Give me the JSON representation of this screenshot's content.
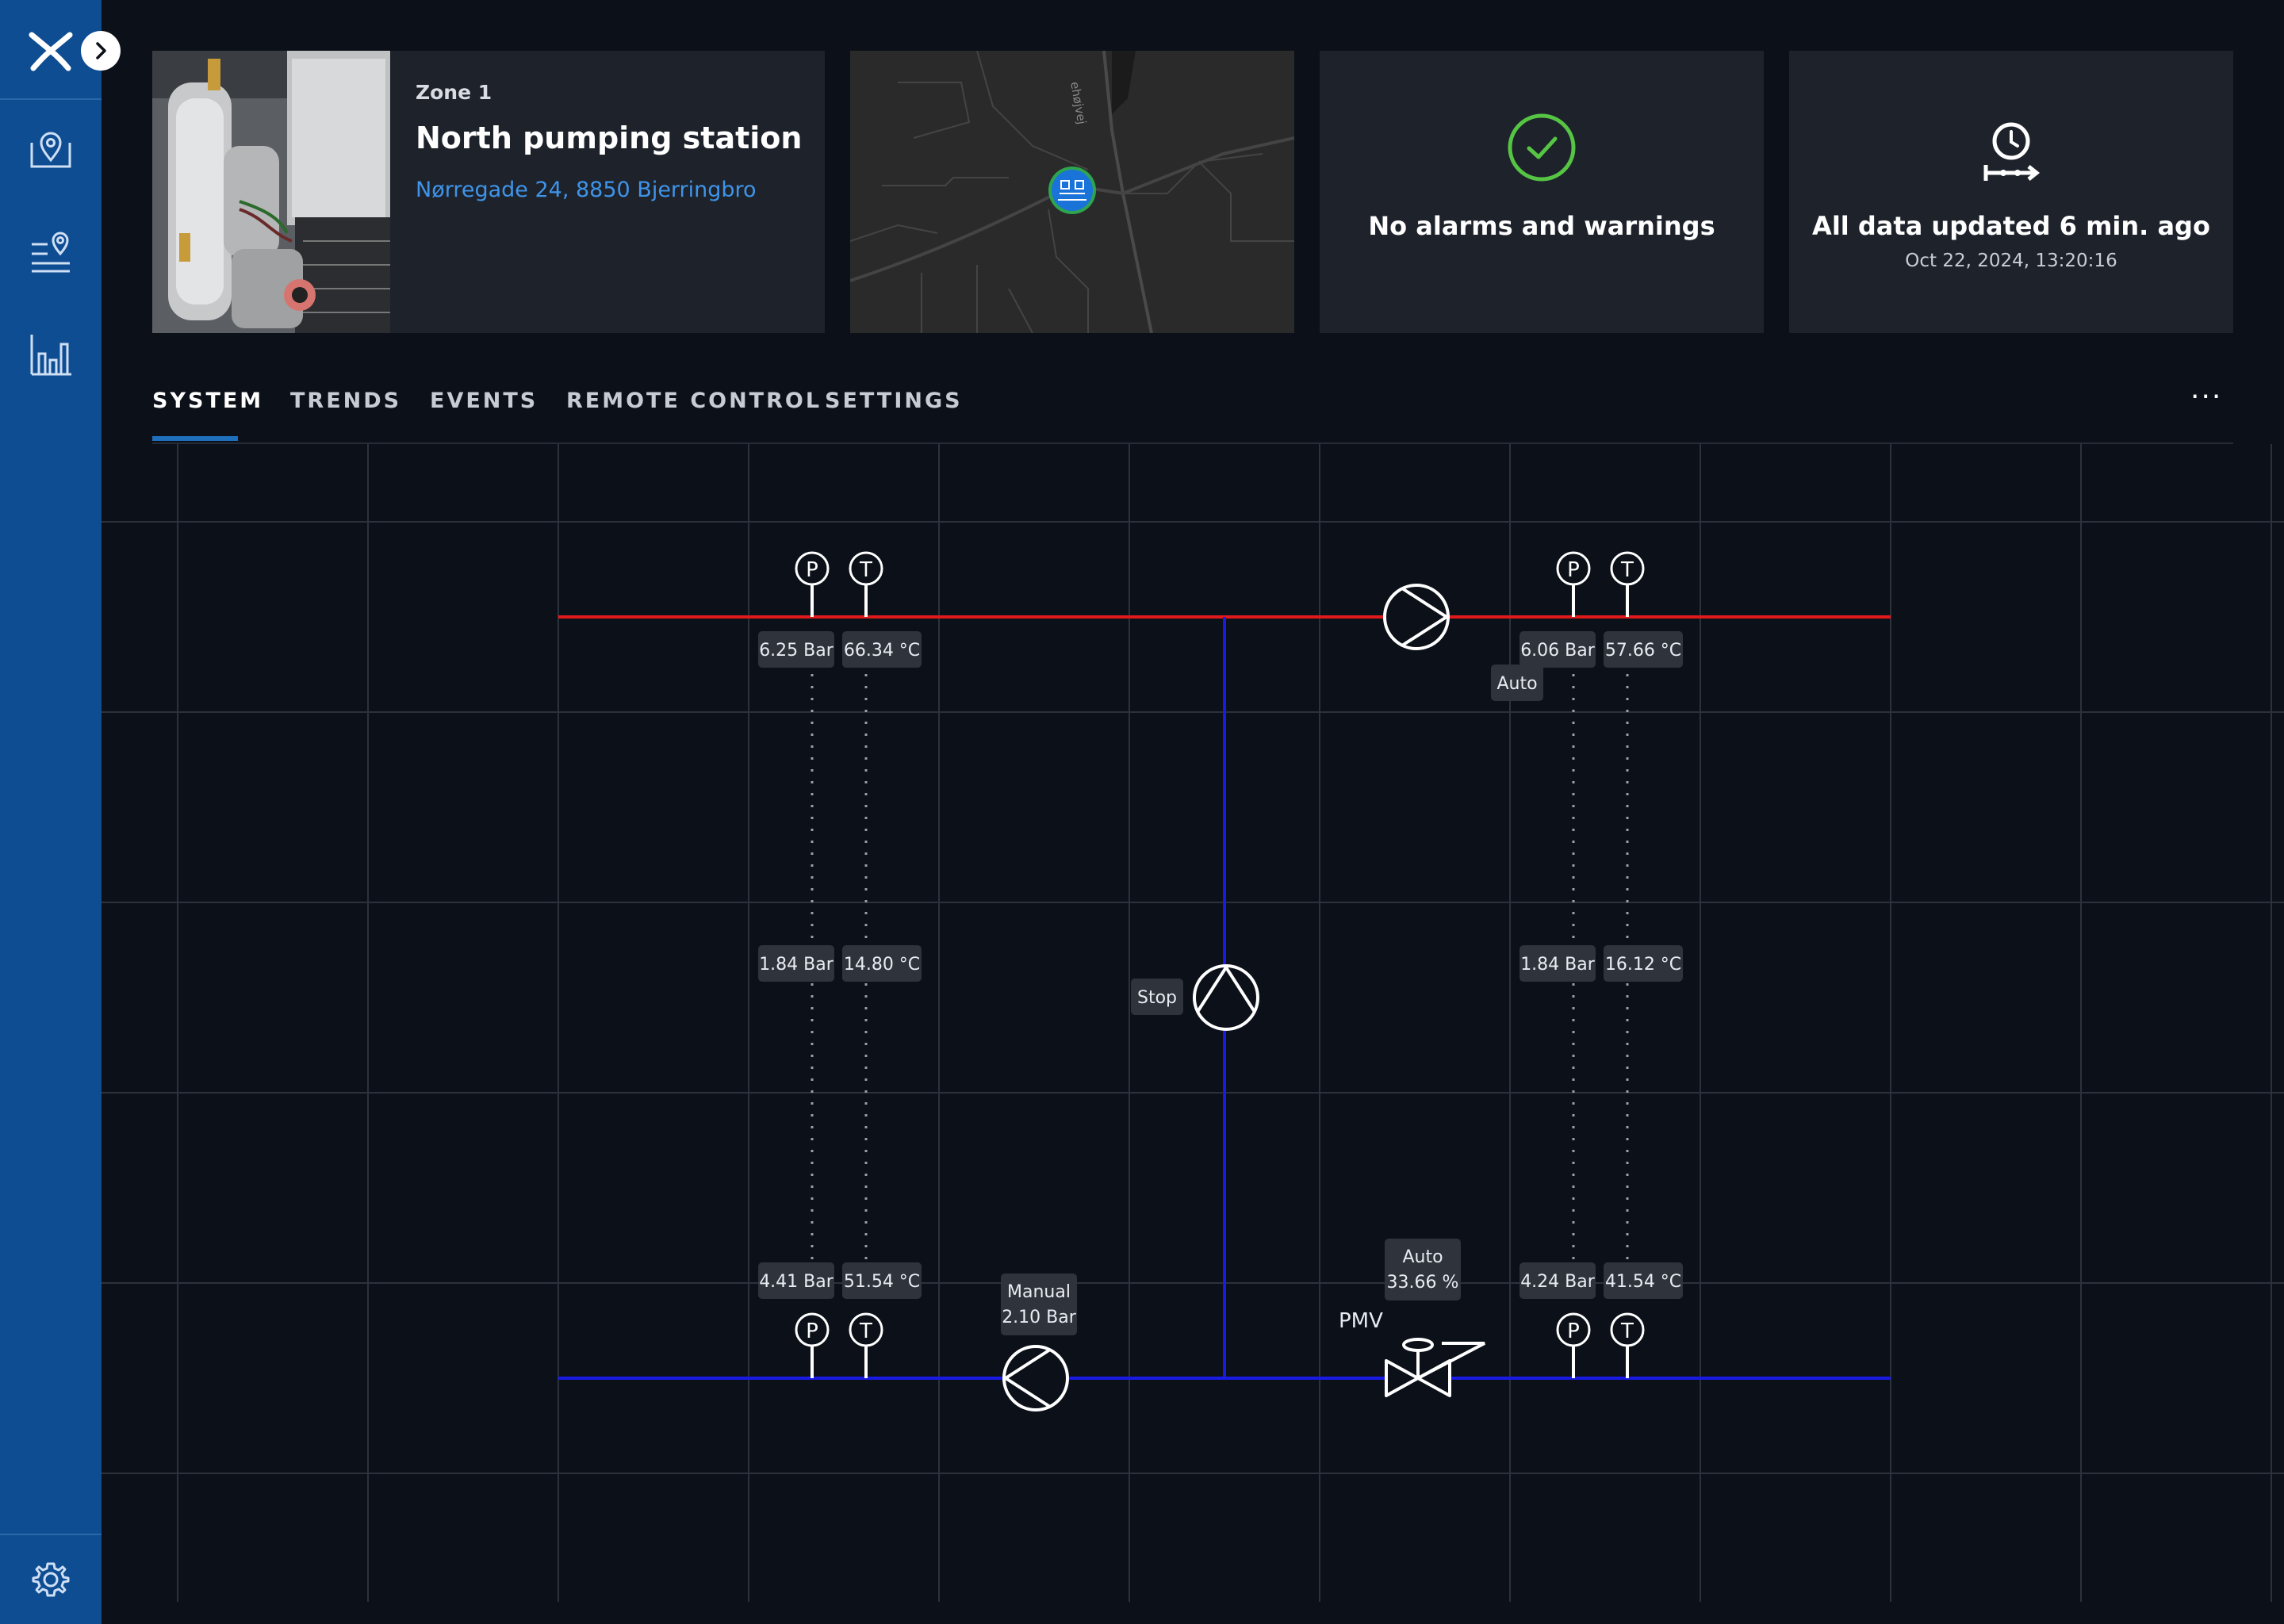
{
  "sidebar": {
    "logo": "brand-logo",
    "expand": "chevron-right-icon",
    "items": [
      {
        "name": "map-pin-icon"
      },
      {
        "name": "list-location-icon"
      },
      {
        "name": "bar-chart-icon"
      }
    ],
    "settings": "gear-icon"
  },
  "header": {
    "zone": "Zone 1",
    "station_name": "North pumping station",
    "address": "Nørregade 24, 8850 Bjerringbro",
    "map_street": "ehøjvej",
    "alarm_status": "No alarms and warnings",
    "update_status": "All data updated 6 min. ago",
    "update_time": "Oct 22, 2024, 13:20:16"
  },
  "tabs": [
    {
      "label": "SYSTEM",
      "active": true
    },
    {
      "label": "TRENDS"
    },
    {
      "label": "EVENTS"
    },
    {
      "label": "REMOTE CONTROL"
    },
    {
      "label": "SETTINGS"
    }
  ],
  "more_label": "···",
  "diagram": {
    "top_left": {
      "pressure": "6.25 Bar",
      "temp": "66.34 °C"
    },
    "top_right": {
      "pressure": "6.06 Bar",
      "temp": "57.66 °C"
    },
    "mid_left": {
      "pressure": "1.84 Bar",
      "temp": "14.80 °C"
    },
    "mid_right": {
      "pressure": "1.84 Bar",
      "temp": "16.12 °C"
    },
    "bottom_left": {
      "pressure": "4.41 Bar",
      "temp": "51.54 °C"
    },
    "bottom_right": {
      "pressure": "4.24 Bar",
      "temp": "41.54 °C"
    },
    "pump_top_status": "Auto",
    "pump_mid_status": "Stop",
    "pump_bottom_mode": "Manual",
    "pump_bottom_value": "2.10 Bar",
    "valve_label": "PMV",
    "valve_mode": "Auto",
    "valve_value": "33.66 %",
    "sensor_p": "P",
    "sensor_t": "T"
  },
  "colors": {
    "sidebar": "#0f4d93",
    "supply_line": "#e01a1a",
    "return_line": "#1a1ae6",
    "ok": "#56c544",
    "link": "#3f94ea"
  }
}
